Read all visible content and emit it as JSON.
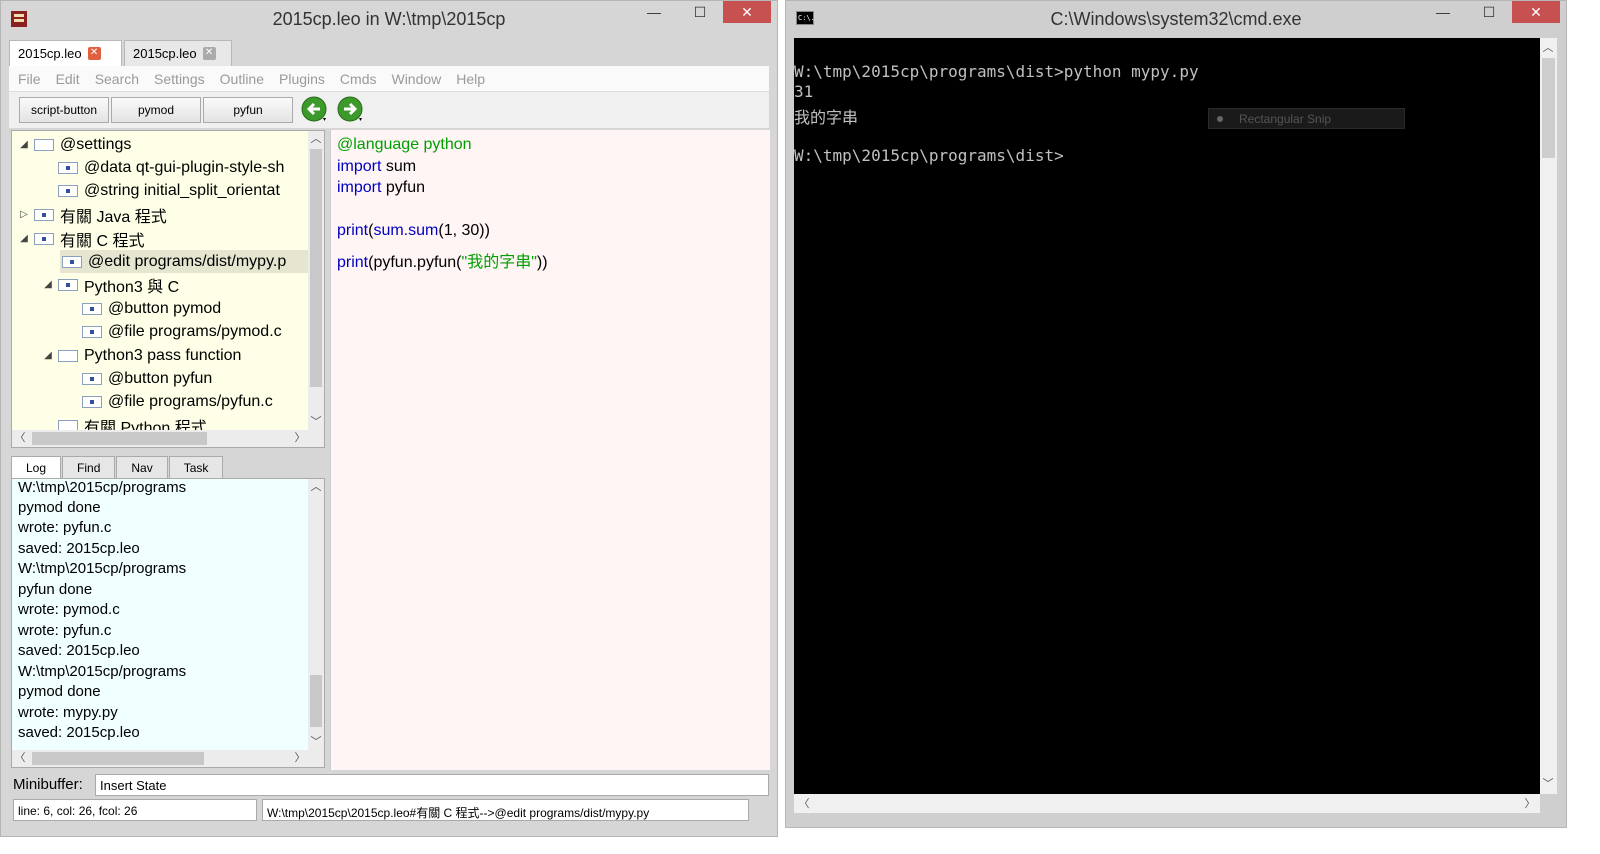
{
  "leo": {
    "title": "2015cp.leo in W:\\tmp\\2015cp",
    "doc_tabs": [
      {
        "label": "2015cp.leo"
      },
      {
        "label": "2015cp.leo"
      }
    ],
    "menu": [
      "File",
      "Edit",
      "Search",
      "Settings",
      "Outline",
      "Plugins",
      "Cmds",
      "Window",
      "Help"
    ],
    "toolbar": {
      "buttons": [
        "script-button",
        "pymod",
        "pyfun"
      ]
    },
    "outline": [
      {
        "label": "@settings",
        "expanded": true
      },
      {
        "label": "@data qt-gui-plugin-style-sh"
      },
      {
        "label": "@string initial_split_orientat"
      },
      {
        "label": "有關 Java 程式",
        "expanded": false
      },
      {
        "label": "有關 C 程式",
        "expanded": true
      },
      {
        "label": "@edit programs/dist/mypy.p",
        "selected": true
      },
      {
        "label": "Python3 與 C",
        "expanded": true
      },
      {
        "label": "@button pymod"
      },
      {
        "label": "@file programs/pymod.c"
      },
      {
        "label": "Python3 pass function",
        "expanded": true
      },
      {
        "label": "@button pyfun"
      },
      {
        "label": "@file programs/pyfun.c"
      },
      {
        "label": "有關 Python 程式"
      }
    ],
    "log_tabs": [
      "Log",
      "Find",
      "Nav",
      "Task"
    ],
    "log_lines": [
      "W:\\tmp\\2015cp/programs",
      "pymod done",
      "wrote: pyfun.c",
      "saved: 2015cp.leo",
      "W:\\tmp\\2015cp/programs",
      "pyfun done",
      "wrote: pymod.c",
      "wrote: pyfun.c",
      "saved: 2015cp.leo",
      "W:\\tmp\\2015cp/programs",
      "pymod done",
      "wrote: mypy.py",
      "saved: 2015cp.leo"
    ],
    "body": {
      "l1": "@language python",
      "l2_kw": "import",
      "l2_rest": " sum",
      "l3_kw": "import",
      "l3_rest": " pyfun",
      "l5_kw": "print",
      "l5_mid": "(",
      "l5_kw2": "sum.sum",
      "l5_rest": "(1, 30))",
      "l6_kw": "print",
      "l6_mid": "(pyfun.pyfun(",
      "l6_str": "\"我的字串\"",
      "l6_end": "))"
    },
    "minibuffer": {
      "label": "Minibuffer:",
      "value": "Insert State"
    },
    "status": {
      "position": "line: 6, col: 26, fcol: 26",
      "path": "W:\\tmp\\2015cp\\2015cp.leo#有關 C 程式-->@edit programs/dist/mypy.py"
    }
  },
  "cmd": {
    "title": "C:\\Windows\\system32\\cmd.exe",
    "icon_text": "C:\\.",
    "lines": [
      "W:\\tmp\\2015cp\\programs\\dist>python mypy.py",
      "31",
      "我的字串",
      "",
      "W:\\tmp\\2015cp\\programs\\dist>"
    ],
    "snip_label": "Rectangular Snip"
  },
  "icons": {
    "min": "—",
    "max": "☐",
    "close": "✕"
  }
}
